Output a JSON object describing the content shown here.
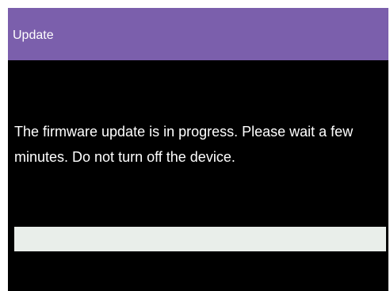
{
  "window": {
    "title": "Update"
  },
  "dialog": {
    "message": "The firmware update is in progress. Please wait a few minutes. Do not turn off the device."
  },
  "progress": {
    "fraction": 1.0
  },
  "colors": {
    "title_bar": "#7b5fac",
    "background": "#000000",
    "text": "#ffffff",
    "progress_fill": "#e9eeea"
  }
}
